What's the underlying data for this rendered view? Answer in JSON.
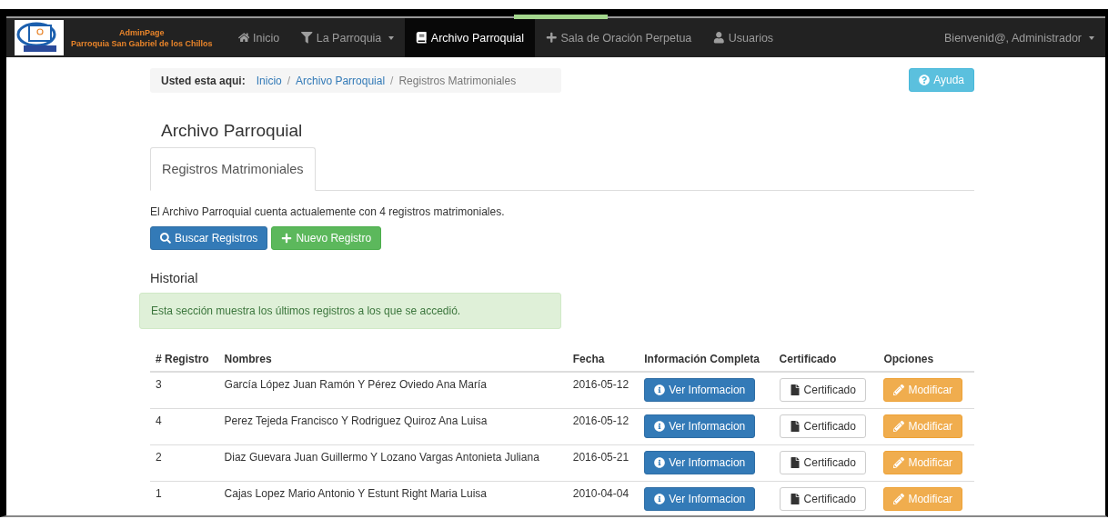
{
  "navbar": {
    "brand": {
      "title": "AdminPage",
      "subtitle": "Parroquia San Gabriel de los Chillos"
    },
    "items": [
      {
        "label": "Inicio",
        "dropdown": false,
        "selected": false
      },
      {
        "label": "La Parroquia",
        "dropdown": true,
        "selected": false
      },
      {
        "label": "Archivo Parroquial",
        "dropdown": false,
        "selected": true
      },
      {
        "label": "Sala de Oración Perpetua",
        "dropdown": false,
        "selected": false
      },
      {
        "label": "Usuarios",
        "dropdown": false,
        "selected": false
      }
    ],
    "user_menu": "Bienvenid@, Administrador"
  },
  "breadcrumb": {
    "label": "Usted esta aqui:",
    "separator": "/",
    "items": [
      {
        "label": "Inicio",
        "link": true
      },
      {
        "label": "Archivo Parroquial",
        "link": true
      },
      {
        "label": "Registros Matrimoniales",
        "link": false
      }
    ]
  },
  "help_button": "Ayuda",
  "page_title": "Archivo Parroquial",
  "tabs": [
    {
      "label": "Registros Matrimoniales",
      "selected": true
    }
  ],
  "summary": "El Archivo Parroquial cuenta actualemente con 4 registros matrimoniales.",
  "actions": [
    "Buscar Registros",
    "Nuevo Registro"
  ],
  "history": {
    "title": "Historial",
    "alert": "Esta sección muestra los últimos registros a los que se accedió."
  },
  "table": {
    "columns": [
      "# Registro",
      "Nombres",
      "Fecha",
      "Información Completa",
      "Certificado",
      "Opciones"
    ],
    "rows": [
      {
        "number": "3",
        "names": "García López Juan Ramón Y Pérez Oviedo Ana María",
        "date": "2016-05-12",
        "info": "Ver Informacion",
        "certificate": "Certificado",
        "option": "Modificar"
      },
      {
        "number": "4",
        "names": "Perez Tejeda Francisco Y Rodriguez Quiroz Ana Luisa",
        "date": "2016-05-12",
        "info": "Ver Informacion",
        "certificate": "Certificado",
        "option": "Modificar"
      },
      {
        "number": "2",
        "names": "Diaz Guevara Juan Guillermo Y Lozano Vargas Antonieta Juliana",
        "date": "2016-05-21",
        "info": "Ver Informacion",
        "certificate": "Certificado",
        "option": "Modificar"
      },
      {
        "number": "1",
        "names": "Cajas Lopez Mario Antonio Y Estunt Right Maria Luisa",
        "date": "2010-04-04",
        "info": "Ver Informacion",
        "certificate": "Certificado",
        "option": "Modificar"
      }
    ]
  }
}
